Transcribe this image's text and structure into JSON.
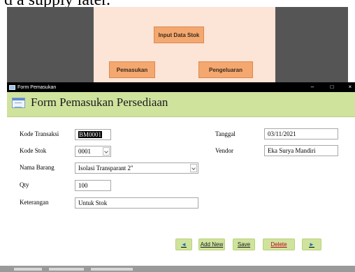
{
  "background": {
    "top_text": "d a supply later.",
    "diagram": {
      "input_button": "Input Data Stok",
      "pemasukan_button": "Pemasukan",
      "pengeluaran_button": "Pengeluaran"
    }
  },
  "window": {
    "title": "Form Pemasukan",
    "minimize": "–",
    "maximize": "□",
    "close": "×"
  },
  "form": {
    "header_title": "Form Pemasukan Persediaan",
    "fields": {
      "kode_transaksi": {
        "label": "Kode Transaksi",
        "value": "BM0001"
      },
      "kode_stok": {
        "label": "Kode Stok",
        "value": "0001"
      },
      "nama_barang": {
        "label": "Nama Barang",
        "value": "Isolasi Transparant 2\""
      },
      "qty": {
        "label": "Qty",
        "value": "100"
      },
      "keterangan": {
        "label": "Keterangan",
        "value": "Untuk Stok"
      },
      "tanggal": {
        "label": "Tanggal",
        "value": "03/11/2021"
      },
      "vendor": {
        "label": "Vendor",
        "value": "Eka Surya Mandiri"
      }
    },
    "buttons": {
      "prev": "◄",
      "add_new": "Add New",
      "save": "Save",
      "delete": "Delete",
      "next": "►"
    }
  },
  "colors": {
    "header_bg": "#cfe39d",
    "button_bg": "#cfe39d",
    "delete_text": "#c0001a",
    "nav_arrow": "#1f6fb2",
    "diagram_button": "#f4a870"
  }
}
